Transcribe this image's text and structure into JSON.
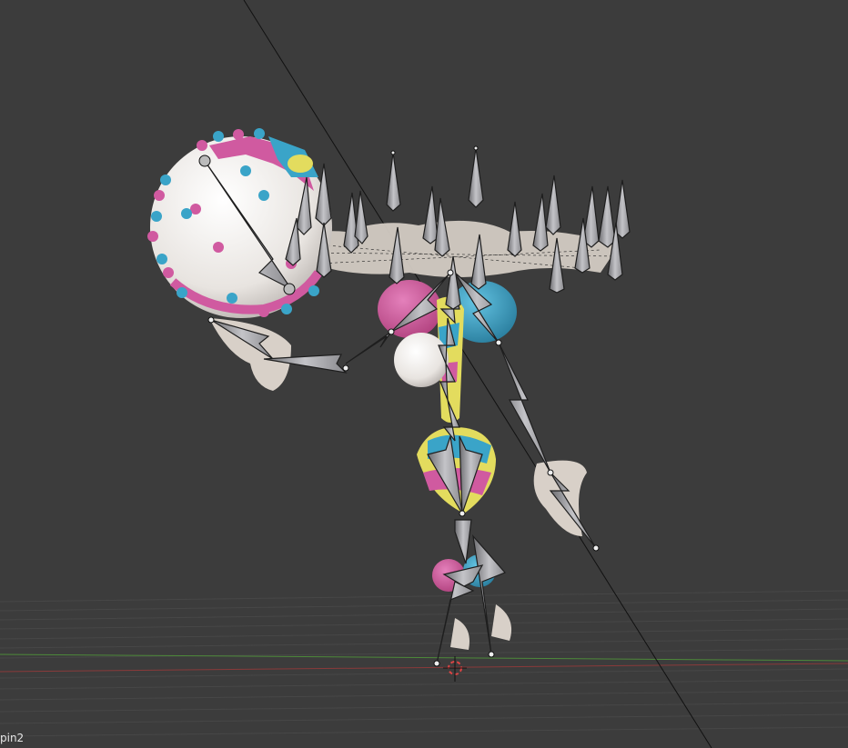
{
  "viewport": {
    "object_name": "pin2"
  },
  "colors": {
    "background": "#3c3c3c",
    "grid_line": "#4a4a4a",
    "x_axis": "#8a3a3a",
    "y_axis": "#4d8a3a",
    "bone_fill": "#9b9b9f",
    "bone_stroke": "#1e1e1e",
    "pink": "#d05aa0",
    "blue": "#3aa4c8",
    "yellow": "#e3dc5e",
    "white": "#f2efec",
    "cream": "#d8d0c8"
  }
}
